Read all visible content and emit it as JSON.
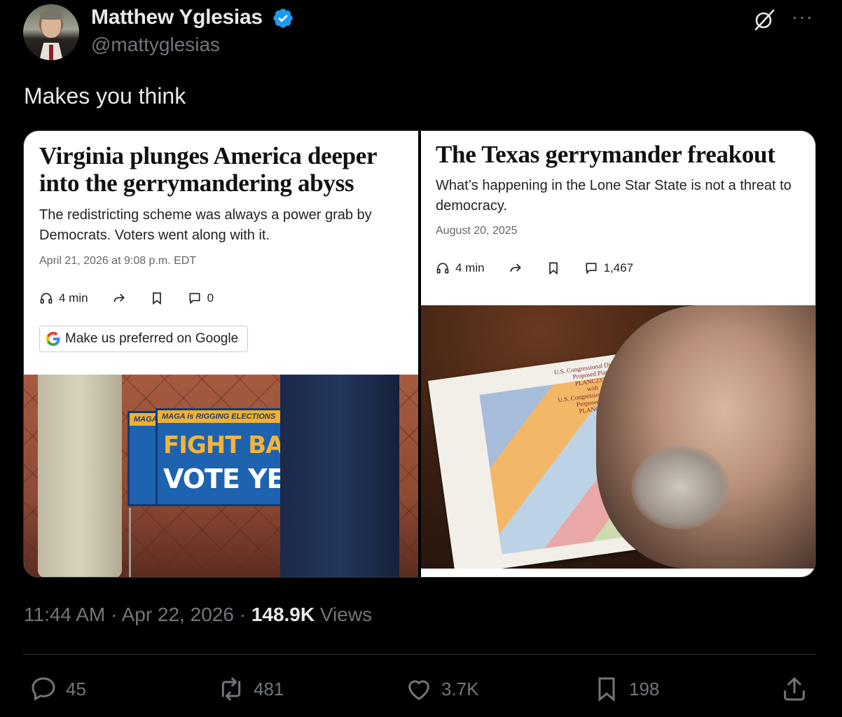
{
  "author": {
    "name": "Matthew Yglesias",
    "handle": "@mattyglesias"
  },
  "tweet": {
    "text": "Makes you think"
  },
  "cards": [
    {
      "headline": "Virginia plunges America deeper into the gerrymandering abyss",
      "dek": "The redistricting scheme was always a power grab by Democrats. Voters went along with it.",
      "date": "April 21, 2026 at 9:08 p.m. EDT",
      "listen": "4 min",
      "comments": "0",
      "google_button": "Make us preferred on Google",
      "photo_sign_strip": "MAGA is RIGGING ELECTIONS",
      "photo_sign_back": "MAGA",
      "photo_sign_line1": "FIGHT BACK",
      "photo_sign_line2": "VOTE YES!"
    },
    {
      "headline": "The Texas gerrymander freakout",
      "dek": "What’s happening in the Lone Star State is not a threat to democracy.",
      "date": "August 20, 2025",
      "listen": "4 min",
      "comments": "1,467",
      "map_label_1": "U.S. Congressional Districts",
      "map_label_2": "Proposed Plan",
      "map_label_3": "PLANC2331",
      "map_label_4": "with",
      "map_label_5": "U.S. Congressional Districts",
      "map_label_6": "Proposed Plan",
      "map_label_7": "PLANC2333"
    }
  ],
  "meta": {
    "time": "11:44 AM",
    "separator": "·",
    "date": "Apr 22, 2026",
    "views_count": "148.9K",
    "views_label": "Views"
  },
  "stats": {
    "replies": "45",
    "reposts": "481",
    "likes": "3.7K",
    "bookmarks": "198"
  },
  "colors": {
    "background": "#000000",
    "text": "#e7e9ea",
    "muted": "#71767b",
    "verified": "#1d9bf0"
  }
}
